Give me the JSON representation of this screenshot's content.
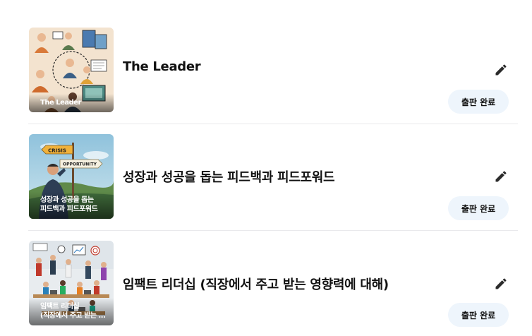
{
  "books": [
    {
      "title": "The Leader",
      "cover_caption_lines": [
        "The Leader"
      ],
      "status_label": "출판 완료",
      "edit_icon": "pencil-icon"
    },
    {
      "title": "성장과 성공을 돕는 피드백과 피드포워드",
      "cover_caption_lines": [
        "성장과 성공을 돕는",
        "피드백과 피드포워드"
      ],
      "cover_sign_top": "CRISIS",
      "cover_sign_bottom": "OPPORTUNITY",
      "status_label": "출판 완료",
      "edit_icon": "pencil-icon"
    },
    {
      "title": "임팩트 리더십 (직장에서 주고 받는 영향력에 대해)",
      "cover_caption_lines": [
        "임팩트 리더십",
        "(직장에서 주고 받는 영향력에 대해)"
      ],
      "status_label": "출판 완료",
      "edit_icon": "pencil-icon"
    }
  ],
  "colors": {
    "status_bg": "#eef5fc",
    "divider": "#e9e9ec",
    "icon": "#2b2b2b"
  }
}
